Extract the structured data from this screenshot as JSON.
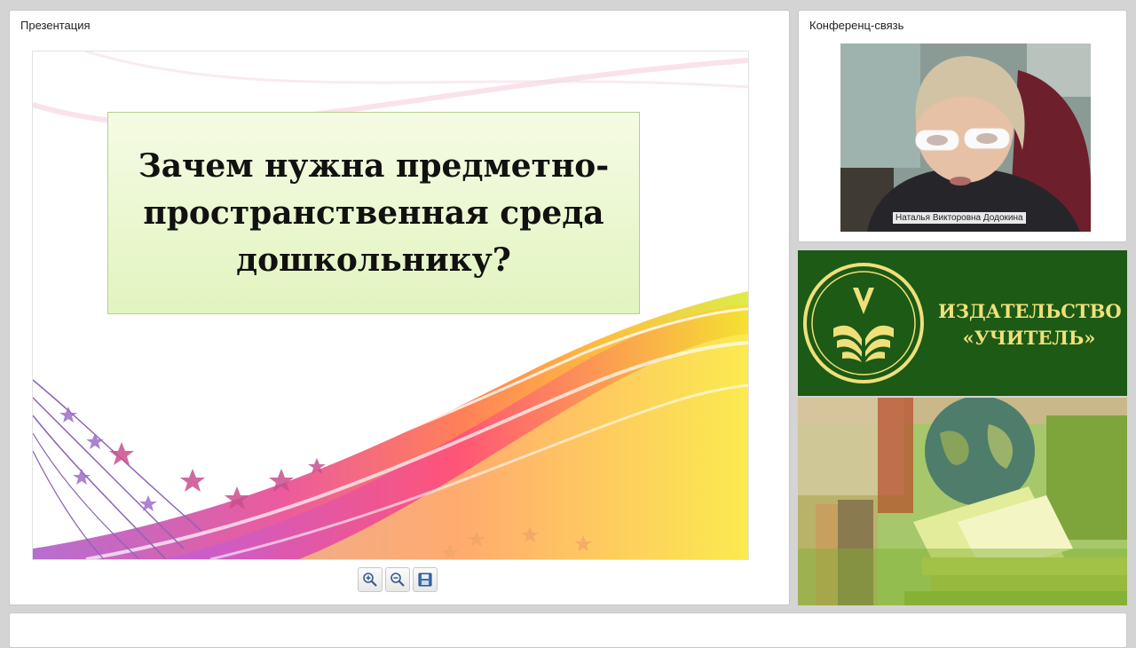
{
  "presentation": {
    "header": "Презентация",
    "slide": {
      "title": "Зачем нужна предметно-пространственная среда дошкольнику?"
    },
    "toolbar": {
      "zoom_in_icon": "zoom-in-icon",
      "zoom_out_icon": "zoom-out-icon",
      "save_icon": "save-icon"
    }
  },
  "conference": {
    "header": "Конференц-связь",
    "participant_name": "Наталья Викторовна Додокина"
  },
  "publisher": {
    "line1": "ИЗДАТЕЛЬСТВО",
    "line2": "«УЧИТЕЛЬ»",
    "logo_color": "#f0e07a",
    "background_color": "#1c5a16"
  }
}
